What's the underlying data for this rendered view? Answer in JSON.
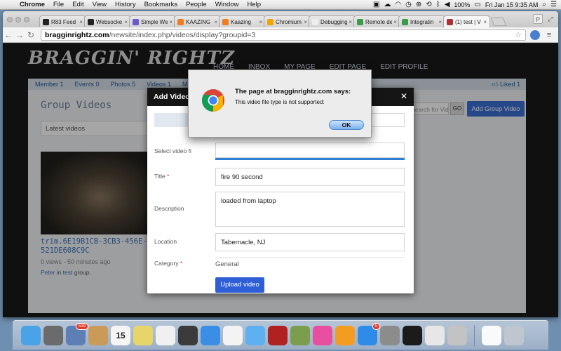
{
  "menubar": {
    "app": "Chrome",
    "items": [
      "File",
      "Edit",
      "View",
      "History",
      "Bookmarks",
      "People",
      "Window",
      "Help"
    ],
    "battery": "100%",
    "clock": "Fri Jan 15  9:35 AM"
  },
  "browser": {
    "tabs": [
      {
        "label": "R83 Feed",
        "color": "#222"
      },
      {
        "label": "Websocke",
        "color": "#222"
      },
      {
        "label": "Simple We",
        "color": "#6a5acd"
      },
      {
        "label": "KAAZING",
        "color": "#f07c22"
      },
      {
        "label": "Kaazing",
        "color": "#f07c22"
      },
      {
        "label": "Chromium",
        "color": "#f0a500"
      },
      {
        "label": "Debugging",
        "color": "#eee"
      },
      {
        "label": "Remote de",
        "color": "#3a9b4b"
      },
      {
        "label": "Integratin",
        "color": "#3a9b4b"
      },
      {
        "label": "(1) test | V",
        "color": "#a33"
      }
    ],
    "url_host": "bragginrightz.com",
    "url_path": "/newsite/index.php/videos/display?groupid=3",
    "profile_initial": "P"
  },
  "site": {
    "logo": "BRAGGIN' RIGHTZ",
    "nav": [
      "HOME",
      "INBOX",
      "MY PAGE",
      "EDIT PAGE",
      "EDIT PROFILE"
    ],
    "subnav": [
      "Member 1",
      "Events 0",
      "Photos 5",
      "Videos 1",
      "Mo"
    ],
    "liked": "Liked 1",
    "group_title": "Group Videos",
    "filter": "Latest videos",
    "search_placeholder": "Search for Videos",
    "go_label": "GO",
    "add_group_video": "Add Group Video",
    "video_name": "trim.6E19B1CB-3CB3-456E-6521DE608C9C",
    "video_meta": "0 views - 50 minutes ago",
    "video_user_link": "Peter",
    "video_user_mid": " in ",
    "video_group_link": "test",
    "video_user_tail": " group."
  },
  "modal": {
    "title": "Add Video",
    "select_label": "Select video fi",
    "title_label": "Title",
    "title_value": "fire 90 second",
    "description_label": "Description",
    "description_value": "loaded from laptop",
    "location_label": "Location",
    "location_value": "Tabernacle, NJ",
    "category_label": "Category",
    "category_value": "General",
    "upload_label": "Upload video",
    "progress": 1.0
  },
  "alert": {
    "title": "The page at bragginrightz.com says:",
    "message": "This video file type is not supported:",
    "ok": "OK"
  },
  "dock": {
    "items": [
      {
        "name": "finder-icon",
        "color": "#4aa3e6"
      },
      {
        "name": "launchpad-icon",
        "color": "#6b6b6b"
      },
      {
        "name": "mail-stamp-icon",
        "color": "#5d7fb5",
        "badge": "519"
      },
      {
        "name": "contacts-icon",
        "color": "#c99a58"
      },
      {
        "name": "calendar-icon",
        "color": "#f5f5f5",
        "text": "15"
      },
      {
        "name": "notes-icon",
        "color": "#e8d56a"
      },
      {
        "name": "reminders-icon",
        "color": "#f0f0f0"
      },
      {
        "name": "facetime-icon",
        "color": "#3b3b3b"
      },
      {
        "name": "safari-icon",
        "color": "#3a8ee6"
      },
      {
        "name": "app-grid-icon",
        "color": "#f3f3f3"
      },
      {
        "name": "messages-icon",
        "color": "#5fb0f0"
      },
      {
        "name": "photo-booth-icon",
        "color": "#b02222"
      },
      {
        "name": "photos-icon",
        "color": "#7b9e4e"
      },
      {
        "name": "itunes-icon",
        "color": "#e84fa0"
      },
      {
        "name": "ibooks-icon",
        "color": "#f39c22"
      },
      {
        "name": "app-store-icon",
        "color": "#2f8be8",
        "badge": "5"
      },
      {
        "name": "system-preferences-icon",
        "color": "#8c8c8c"
      },
      {
        "name": "terminal-icon",
        "color": "#1b1b1b"
      },
      {
        "name": "chrome-icon",
        "color": "#e7e7e7"
      },
      {
        "name": "pen-tool-icon",
        "color": "#c3c3c3"
      },
      {
        "name": "document-icon",
        "color": "#fafafa"
      },
      {
        "name": "trash-icon",
        "color": "#bfc6cf"
      }
    ]
  }
}
